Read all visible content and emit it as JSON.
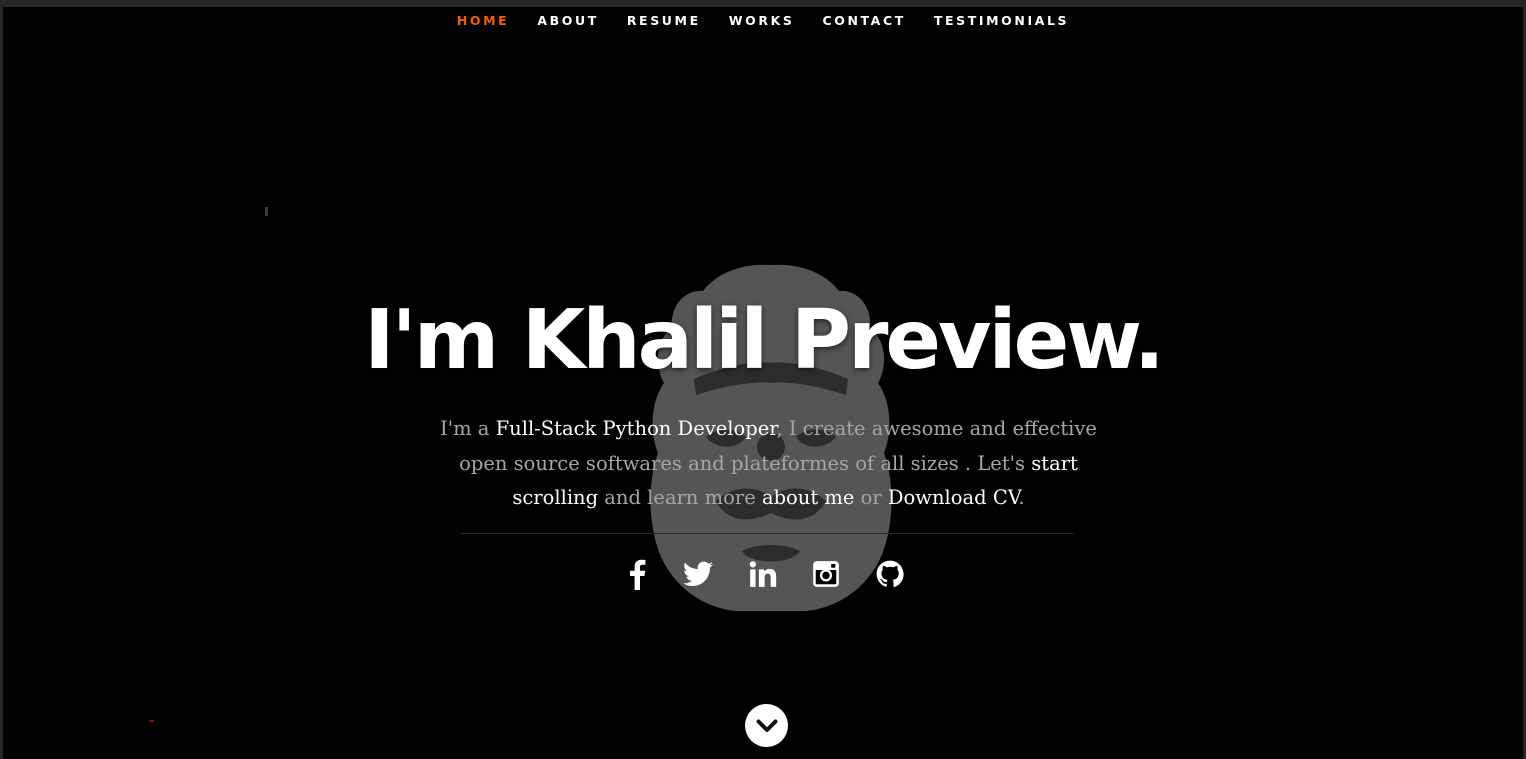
{
  "nav": {
    "items": [
      {
        "label": "HOME",
        "active": true
      },
      {
        "label": "ABOUT",
        "active": false
      },
      {
        "label": "RESUME",
        "active": false
      },
      {
        "label": "WORKS",
        "active": false
      },
      {
        "label": "CONTACT",
        "active": false
      },
      {
        "label": "TESTIMONIALS",
        "active": false
      }
    ],
    "active_color": "#f06000"
  },
  "hero": {
    "title": "I'm Khalil Preview.",
    "intro": {
      "p1": "I'm a ",
      "role": "Full-Stack Python Developer",
      "p2": ", I create awesome and effective open source softwares and plateformes of all sizes . Let's ",
      "scroll_link": "start scrolling",
      "p3": " and learn more ",
      "about_link": "about me",
      "p4": " or ",
      "cv_link": "Download CV",
      "p5": "."
    }
  },
  "social": {
    "icons": [
      "facebook-icon",
      "twitter-icon",
      "linkedin-icon",
      "instagram-icon",
      "github-icon"
    ]
  },
  "scroll_button": {
    "icon": "chevron-down-icon"
  },
  "colors": {
    "background": "#020202",
    "text_primary": "#ffffff",
    "text_muted": "#a6a6a6"
  }
}
